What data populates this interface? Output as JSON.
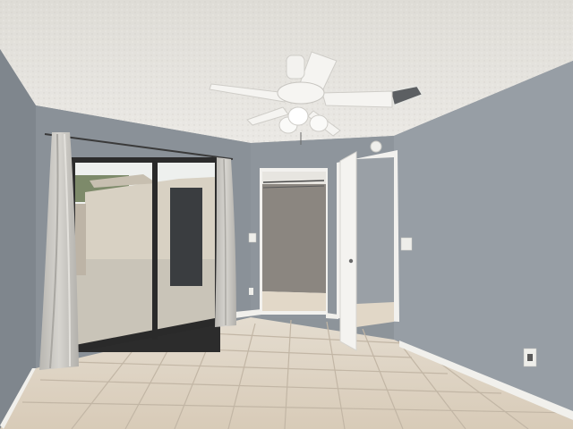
{
  "scene": {
    "description_free": true,
    "palette": {
      "ceiling": "#e6e4df",
      "wall_back": "#8e959c",
      "wall_right": "#979ea5",
      "wall_left": "#7f868d",
      "floor": "#ddd2c2",
      "grout": "#bfb3a2",
      "trim": "#f3f2ef",
      "door": "#f4f3f0",
      "curtain": "#c9c7c2",
      "closet_interior": "#8b8680",
      "outdoor_wall": "#d8d1c3",
      "outdoor_ground": "#c9c4b8",
      "sky": "#f1f2f0"
    }
  }
}
